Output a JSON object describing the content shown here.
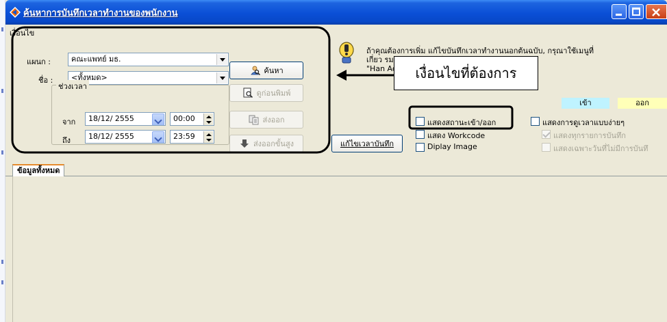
{
  "window": {
    "title": "ค้นหาการบันทึกเวลาทำงานของพนักงาน"
  },
  "filter": {
    "group_label": "เงื่อนไข",
    "department_label": "แผนก :",
    "department_value": "คณะแพทย์ มธ.",
    "name_label": "ชื่อ :",
    "name_value": "<ทั้งหมด>",
    "period_label": "ช่วงเวลา",
    "from_label": "จาก",
    "to_label": "ถึง",
    "from_date": "18/12/ 2555",
    "from_time": "00:00",
    "to_date": "18/12/ 2555",
    "to_time": "23:59"
  },
  "buttons": {
    "search": "ค้นหา",
    "print_preview": "ดูก่อนพิมพ์",
    "export": "ส่งออก",
    "advanced_export": "ส่งออกขั้นสูง",
    "edit_record": "แก้ไขเวลาบันทึก"
  },
  "info": {
    "line1": "ถ้าคุณต้องการเพิ่ม แก้ไขบันทึกเวลาทำงานนอกต้นฉบับ, กรุณาใช้เมนูที่",
    "line2": "เกี่ยว                                                      รมทำงานสาย\" หรือ",
    "line3": "\"Han                                                     Advance\"."
  },
  "callout": {
    "text": "เงื่อนไขที่ต้องการ"
  },
  "legend": {
    "in": "เข้า",
    "out": "ออก",
    "in_color": "#bff3ff",
    "out_color": "#ffffb8"
  },
  "options": {
    "show_in_out": "แสดงสถานะเข้า/ออก",
    "show_workcode": "แสดง Workcode",
    "display_image": "Diplay Image",
    "simple_view": "แสดงการดูเวลาแบบง่ายๆ",
    "show_all_records": "แสดงทุกรายการบันทึก",
    "show_no_record_days": "แสดงเฉพาะวันที่ไม่มีการบันทึ"
  },
  "tabs": [
    {
      "label": "ข้อมูลทั้งหมด"
    }
  ],
  "colors": {
    "titlebar": "#0a4fd6",
    "window_bg": "#ece9d8",
    "annotation": "#000000"
  }
}
